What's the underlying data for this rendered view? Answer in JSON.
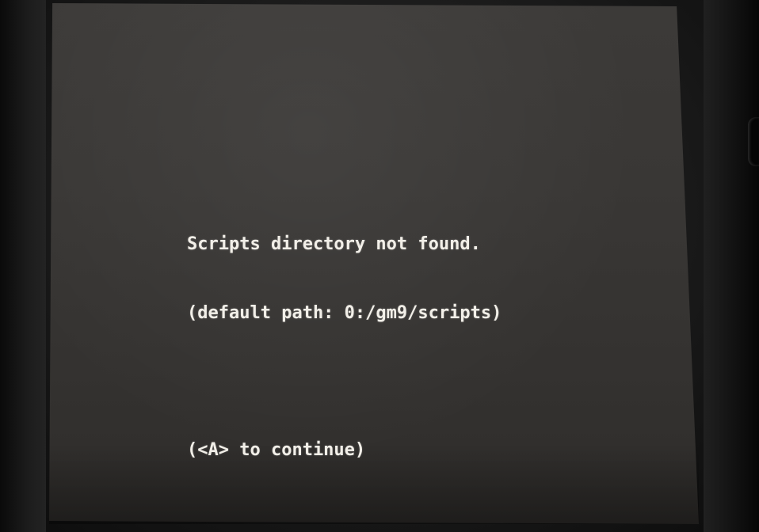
{
  "dialog": {
    "line1": "Scripts directory not found.",
    "line2": "(default path: 0:/gm9/scripts)",
    "prompt": "(<A> to continue)"
  },
  "colors": {
    "screen_background": "#393735",
    "text": "#f2efe8",
    "bezel": "#1a1a1a"
  }
}
